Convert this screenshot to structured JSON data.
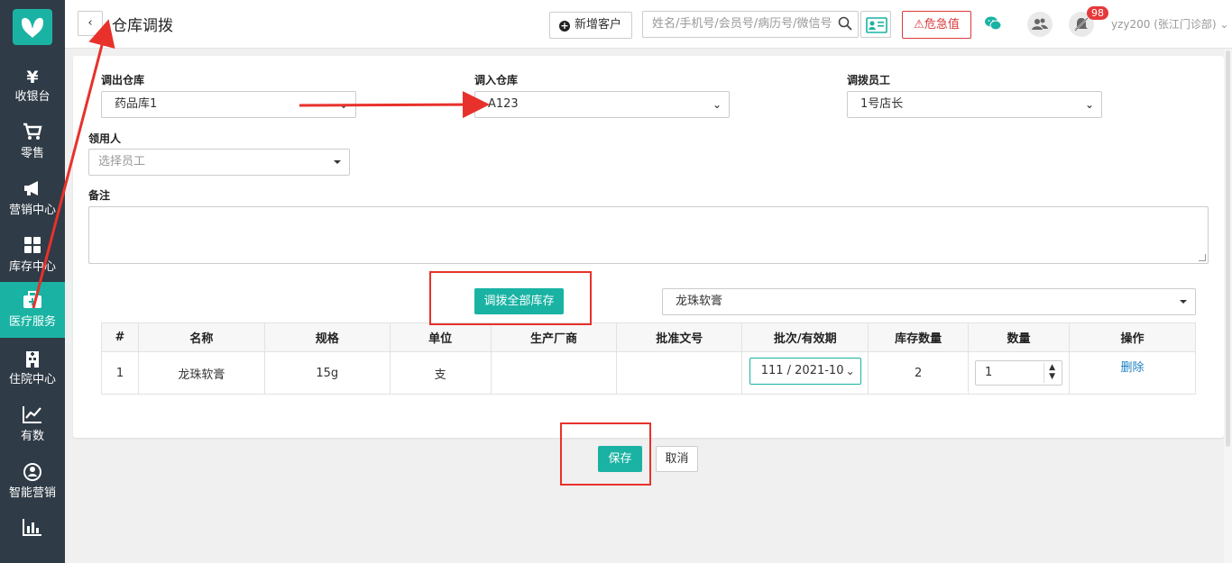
{
  "sidebar": {
    "items": [
      {
        "icon": "¥",
        "label": "收银台"
      },
      {
        "icon": "cart",
        "label": "零售"
      },
      {
        "icon": "megaphone",
        "label": "营销中心"
      },
      {
        "icon": "grid",
        "label": "库存中心"
      },
      {
        "icon": "medkit",
        "label": "医疗服务"
      },
      {
        "icon": "hospital",
        "label": "住院中心"
      },
      {
        "icon": "chart-line",
        "label": "有数"
      },
      {
        "icon": "smart",
        "label": "智能营销"
      },
      {
        "icon": "bar-chart",
        "label": ""
      }
    ],
    "active_index": 4
  },
  "header": {
    "back_label": "‹",
    "title": "仓库调拨",
    "add_customer_label": "新增客户",
    "search_placeholder": "姓名/手机号/会员号/病历号/微信号",
    "danger_label": "危急值",
    "notification_count": "98",
    "user_name": "yzy200 (张江门诊部)"
  },
  "form": {
    "out_warehouse_label": "调出仓库",
    "out_warehouse_value": "药品库1",
    "in_warehouse_label": "调入仓库",
    "in_warehouse_value": "A123",
    "staff_label": "调拨员工",
    "staff_value": "1号店长",
    "receiver_label": "领用人",
    "receiver_placeholder": "选择员工",
    "remark_label": "备注",
    "transfer_all_label": "调拨全部库存",
    "product_value": "龙珠软膏"
  },
  "table": {
    "headers": [
      "#",
      "名称",
      "规格",
      "单位",
      "生产厂商",
      "批准文号",
      "批次/有效期",
      "库存数量",
      "数量",
      "操作"
    ],
    "rows": [
      {
        "index": "1",
        "name": "龙珠软膏",
        "spec": "15g",
        "unit": "支",
        "manufacturer": "",
        "approval": "",
        "batch": "111 / 2021-10",
        "stock": "2",
        "qty": "1",
        "action": "删除"
      }
    ]
  },
  "footer": {
    "save_label": "保存",
    "cancel_label": "取消"
  },
  "colors": {
    "accent": "#1ab3a3",
    "sidebar_bg": "#2f3b46",
    "danger": "#d93b3b",
    "annotation": "#e8312b"
  }
}
